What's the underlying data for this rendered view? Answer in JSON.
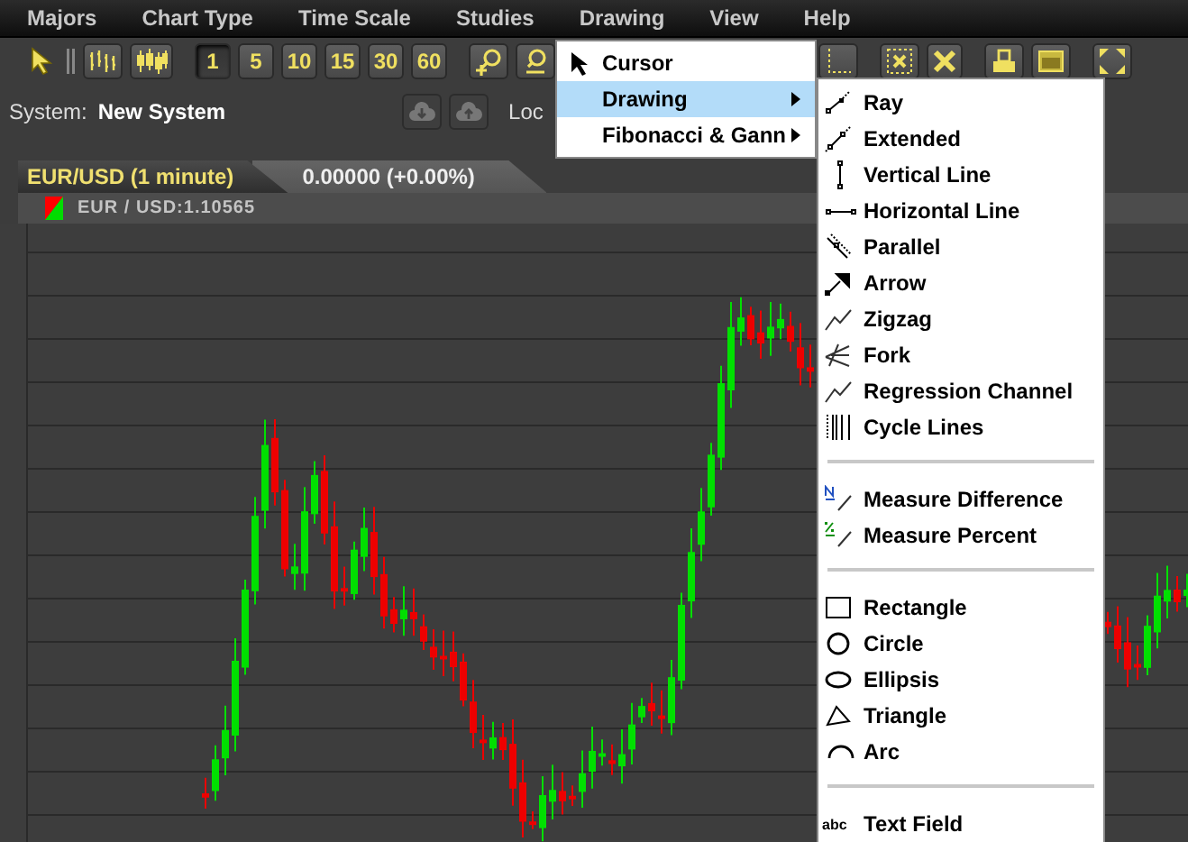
{
  "menu_bar": [
    {
      "label": "Majors"
    },
    {
      "label": "Chart Type"
    },
    {
      "label": "Time Scale"
    },
    {
      "label": "Studies"
    },
    {
      "label": "Drawing"
    },
    {
      "label": "View"
    },
    {
      "label": "Help"
    }
  ],
  "toolbar": {
    "time_buttons": [
      {
        "label": "1",
        "selected": true
      },
      {
        "label": "5",
        "selected": false
      },
      {
        "label": "10",
        "selected": false
      },
      {
        "label": "15",
        "selected": false
      },
      {
        "label": "30",
        "selected": false
      },
      {
        "label": "60",
        "selected": false
      }
    ]
  },
  "system": {
    "label": "System:",
    "value": "New System",
    "lock_label": "Loc"
  },
  "chart": {
    "tab_title": "EUR/USD (1 minute)",
    "change": "0.00000 (+0.00%)",
    "symbol": "EUR / USD:1.10565"
  },
  "drawing_menu": {
    "items": [
      {
        "kind": "cursor",
        "label": "Cursor",
        "selected": false,
        "has_submenu": false
      },
      {
        "kind": "plain",
        "label": "Drawing",
        "selected": true,
        "has_submenu": true
      },
      {
        "kind": "plain",
        "label": "Fibonacci & Gann",
        "selected": false,
        "has_submenu": true
      }
    ]
  },
  "drawing_submenu": {
    "items": [
      {
        "kind": "ray",
        "label": "Ray"
      },
      {
        "kind": "extended",
        "label": "Extended"
      },
      {
        "kind": "vline",
        "label": "Vertical Line"
      },
      {
        "kind": "hline",
        "label": "Horizontal Line"
      },
      {
        "kind": "parallel",
        "label": "Parallel"
      },
      {
        "kind": "arrow",
        "label": "Arrow"
      },
      {
        "kind": "zigzag",
        "label": "Zigzag"
      },
      {
        "kind": "fork",
        "label": "Fork"
      },
      {
        "kind": "regression",
        "label": "Regression Channel"
      },
      {
        "kind": "cycle",
        "label": "Cycle Lines"
      },
      {
        "kind": "separator"
      },
      {
        "kind": "measure_difference",
        "label": "Measure Difference"
      },
      {
        "kind": "measure_percent",
        "label": "Measure Percent"
      },
      {
        "kind": "separator"
      },
      {
        "kind": "rectangle",
        "label": "Rectangle"
      },
      {
        "kind": "circle",
        "label": "Circle"
      },
      {
        "kind": "ellipse",
        "label": "Ellipsis"
      },
      {
        "kind": "triangle",
        "label": "Triangle"
      },
      {
        "kind": "arc",
        "label": "Arc"
      },
      {
        "kind": "separator"
      },
      {
        "kind": "text",
        "icon_label": "abc",
        "label": "Text Field"
      }
    ]
  }
}
